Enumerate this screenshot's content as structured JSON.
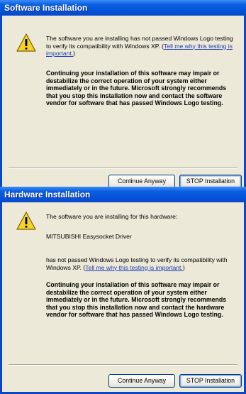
{
  "software_dialog": {
    "title": "Software Installation",
    "icon": "warning-icon",
    "message_text": "The software you are installing has not passed Windows Logo testing to verify its compatibility with Windows XP. (",
    "message_link": "Tell me why this testing is important.",
    "message_end": ")",
    "warning": "Continuing your installation of this software may impair or destabilize the correct operation of your system either immediately or in the future. Microsoft strongly recommends that you stop this installation now and contact the software vendor for software that has passed Windows Logo testing.",
    "continue_label": "Continue Anyway",
    "stop_label": "STOP Installation"
  },
  "hardware_dialog": {
    "title": "Hardware Installation",
    "icon": "warning-icon",
    "intro": "The software you are installing for this hardware:",
    "device_name": "MITSUBISHI Easysocket Driver",
    "message_text": "has not passed Windows Logo testing to verify its compatibility with Windows XP. (",
    "message_link": "Tell me why this testing is important.",
    "message_end": ")",
    "warning": "Continuing your installation of this software may impair or destabilize the correct operation of your system either immediately or in the future. Microsoft strongly recommends that you stop this installation now and contact the hardware vendor for software that has passed Windows Logo testing.",
    "continue_label": "Continue Anyway",
    "stop_label": "STOP Installation"
  },
  "colors": {
    "titlebar": "#0a5fe0",
    "dialog_bg": "#ece9d8",
    "link": "#1d3bb4",
    "warning_icon": "#f5d327"
  }
}
